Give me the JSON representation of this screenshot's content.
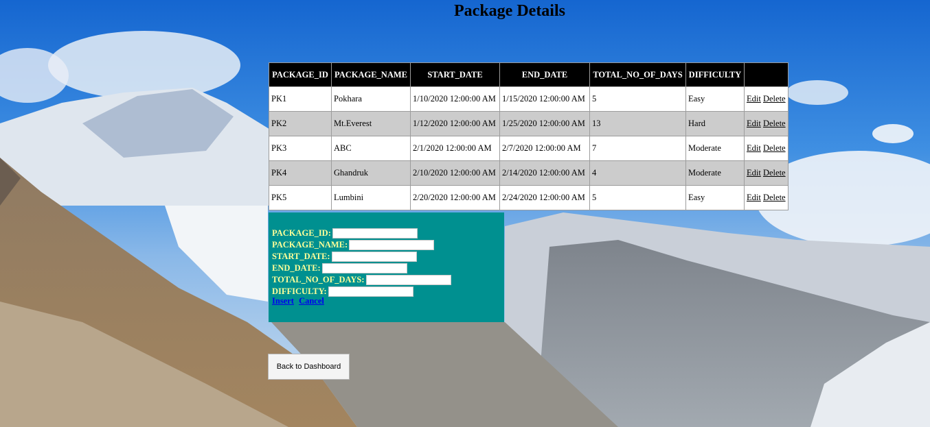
{
  "page": {
    "title": "Package Details"
  },
  "table": {
    "headers": [
      "PACKAGE_ID",
      "PACKAGE_NAME",
      "START_DATE",
      "END_DATE",
      "TOTAL_NO_OF_DAYS",
      "DIFFICULTY",
      ""
    ],
    "rows": [
      {
        "id": "PK1",
        "name": "Pokhara",
        "start": "1/10/2020 12:00:00 AM",
        "end": "1/15/2020 12:00:00 AM",
        "days": "5",
        "difficulty": "Easy",
        "edit": "Edit",
        "delete": "Delete"
      },
      {
        "id": "PK2",
        "name": "Mt.Everest",
        "start": "1/12/2020 12:00:00 AM",
        "end": "1/25/2020 12:00:00 AM",
        "days": "13",
        "difficulty": "Hard",
        "edit": "Edit",
        "delete": "Delete"
      },
      {
        "id": "PK3",
        "name": "ABC",
        "start": "2/1/2020 12:00:00 AM",
        "end": "2/7/2020 12:00:00 AM",
        "days": "7",
        "difficulty": "Moderate",
        "edit": "Edit",
        "delete": "Delete"
      },
      {
        "id": "PK4",
        "name": "Ghandruk",
        "start": "2/10/2020 12:00:00 AM",
        "end": "2/14/2020 12:00:00 AM",
        "days": "4",
        "difficulty": "Moderate",
        "edit": "Edit",
        "delete": "Delete"
      },
      {
        "id": "PK5",
        "name": "Lumbini",
        "start": "2/20/2020 12:00:00 AM",
        "end": "2/24/2020 12:00:00 AM",
        "days": "5",
        "difficulty": "Easy",
        "edit": "Edit",
        "delete": "Delete"
      }
    ]
  },
  "form": {
    "fields": [
      {
        "label": "PACKAGE_ID:",
        "value": ""
      },
      {
        "label": "PACKAGE_NAME:",
        "value": ""
      },
      {
        "label": "START_DATE:",
        "value": ""
      },
      {
        "label": "END_DATE:",
        "value": ""
      },
      {
        "label": "TOTAL_NO_OF_DAYS:",
        "value": ""
      },
      {
        "label": "DIFFICULTY:",
        "value": ""
      }
    ],
    "insert_label": "Insert",
    "cancel_label": "Cancel"
  },
  "back_button": {
    "label": "Back to Dashboard"
  },
  "colors": {
    "header_bg": "#000000",
    "alt_row_bg": "#cccccc",
    "form_bg": "#009090",
    "form_label": "#ffff99"
  }
}
